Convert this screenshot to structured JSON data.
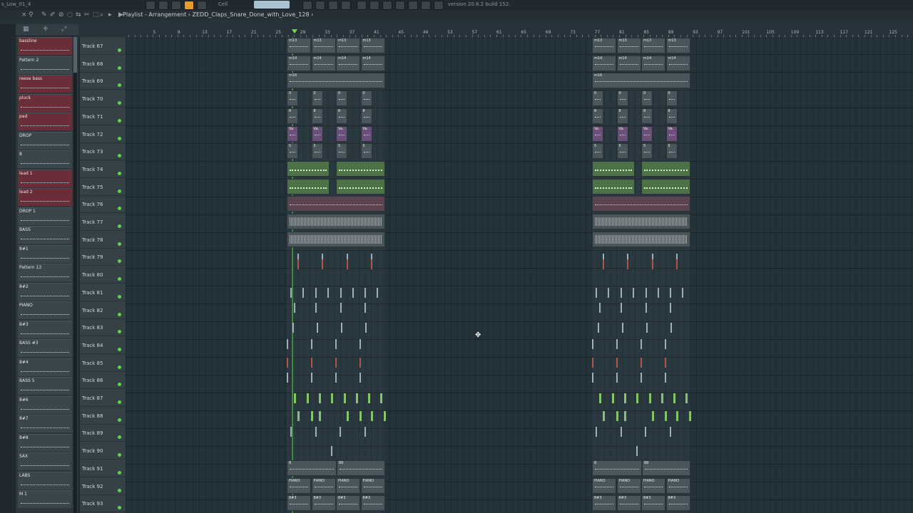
{
  "window": {
    "title_fragment": "s_Low_01_4",
    "hint_text": "version 20.8.2 build 152.",
    "cell_label": "Cell"
  },
  "breadcrumb": {
    "text": "Playlist - Arrangement › ZEDD_Claps_Snare_Done_with_Love_128 ›"
  },
  "ruler": {
    "bars": [
      5,
      9,
      13,
      17,
      21,
      25,
      29,
      33,
      37,
      41,
      45,
      49,
      53,
      57,
      61,
      65,
      69,
      73,
      77,
      81,
      85,
      89,
      93,
      97,
      101,
      105,
      109,
      113,
      117,
      121,
      125,
      129
    ]
  },
  "patterns": [
    {
      "label": "bassline",
      "red": true
    },
    {
      "label": "Pattern 2",
      "red": false
    },
    {
      "label": "reese bass",
      "red": true
    },
    {
      "label": "pluck",
      "red": true
    },
    {
      "label": "pad",
      "red": true
    },
    {
      "label": "DROP",
      "red": false
    },
    {
      "label": "8",
      "red": false
    },
    {
      "label": "lead 1",
      "red": true
    },
    {
      "label": "lead 2",
      "red": true
    },
    {
      "label": "DROP 1",
      "red": false
    },
    {
      "label": "BASS",
      "red": false
    },
    {
      "label": "8#1",
      "red": false
    },
    {
      "label": "Pattern 13",
      "red": false
    },
    {
      "label": "8#2",
      "red": false
    },
    {
      "label": "PIANO",
      "red": false
    },
    {
      "label": "8#3",
      "red": false
    },
    {
      "label": "BASS #3",
      "red": false
    },
    {
      "label": "8#4",
      "red": false
    },
    {
      "label": "BASS 5",
      "red": false
    },
    {
      "label": "8#6",
      "red": false
    },
    {
      "label": "8#7",
      "red": false
    },
    {
      "label": "8#8",
      "red": false
    },
    {
      "label": "SAX",
      "red": false
    },
    {
      "label": "LABS",
      "red": false
    },
    {
      "label": "M 1",
      "red": false
    }
  ],
  "tracks": [
    "Track 67",
    "Track 68",
    "Track 69",
    "Track 70",
    "Track 71",
    "Track 72",
    "Track 73",
    "Track 74",
    "Track 75",
    "Track 76",
    "Track 77",
    "Track 78",
    "Track 79",
    "Track 80",
    "Track 81",
    "Track 82",
    "Track 83",
    "Track 84",
    "Track 85",
    "Track 86",
    "Track 87",
    "Track 88",
    "Track 89",
    "Track 90",
    "Track 91",
    "Track 92",
    "Track 93"
  ],
  "clips": {
    "m13": "m13",
    "m14": "m14",
    "m16": "m16",
    "b0": "0",
    "b8": "8",
    "va": "Va.",
    "s5": "5",
    "piano": "PIANO",
    "b88": "88",
    "b83": "8#3"
  }
}
